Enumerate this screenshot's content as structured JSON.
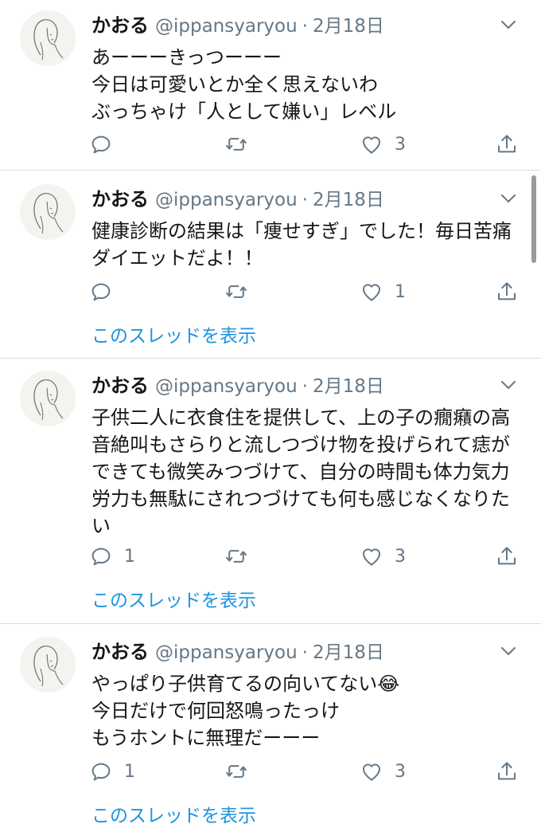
{
  "tweets": [
    {
      "name": "かおる",
      "handle": "@ippansyaryou",
      "separator": "·",
      "date": "2月18日",
      "text": "あーーーきっつーーー\n今日は可愛いとか全く思えないわ\nぶっちゃけ「人として嫌い」レベル",
      "reply_count": "",
      "retweet_count": "",
      "like_count": "3"
    },
    {
      "name": "かおる",
      "handle": "@ippansyaryou",
      "separator": "·",
      "date": "2月18日",
      "text": "健康診断の結果は「痩せすぎ」でした！毎日苦痛ダイエットだよ！！",
      "reply_count": "",
      "retweet_count": "",
      "like_count": "1",
      "thread_link": "このスレッドを表示"
    },
    {
      "name": "かおる",
      "handle": "@ippansyaryou",
      "separator": "·",
      "date": "2月18日",
      "text": "子供二人に衣食住を提供して、上の子の癇癪の高音絶叫もさらりと流しつづけ物を投げられて痣ができても微笑みつづけて、自分の時間も体力気力労力も無駄にされつづけても何も感じなくなりたい",
      "reply_count": "1",
      "retweet_count": "",
      "like_count": "3",
      "thread_link": "このスレッドを表示"
    },
    {
      "name": "かおる",
      "handle": "@ippansyaryou",
      "separator": "·",
      "date": "2月18日",
      "text": "やっぱり子供育てるの向いてない😂\n今日だけで何回怒鳴ったっけ\nもうホントに無理だーーー",
      "reply_count": "1",
      "retweet_count": "",
      "like_count": "3",
      "thread_link": "このスレッドを表示"
    }
  ],
  "icons": {
    "reply": "reply-icon",
    "retweet": "retweet-icon",
    "like": "heart-icon",
    "share": "share-icon",
    "caret": "chevron-down-icon"
  },
  "colors": {
    "link": "#1b95e0",
    "secondary_text": "#657786",
    "divider": "#d8dee3"
  }
}
